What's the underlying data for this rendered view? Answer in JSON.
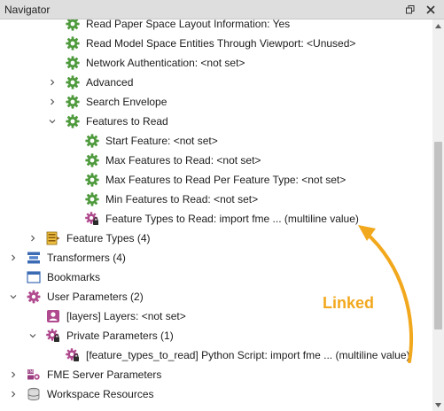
{
  "panel": {
    "title": "Navigator"
  },
  "annotation": {
    "text": "Linked",
    "color": "#f2a81d"
  },
  "tree": [
    {
      "id": "read-paper-space",
      "label": "Read Paper Space Layout Information: Yes",
      "icon": "gear-icon",
      "expander": "none"
    },
    {
      "id": "read-model-space",
      "label": "Read Model Space Entities Through Viewport: <Unused>",
      "icon": "gear-icon",
      "expander": "none"
    },
    {
      "id": "network-authentication",
      "label": "Network Authentication: <not set>",
      "icon": "gear-icon",
      "expander": "none"
    },
    {
      "id": "advanced",
      "label": "Advanced",
      "icon": "gear-icon",
      "expander": "collapsed"
    },
    {
      "id": "search-envelope",
      "label": "Search Envelope",
      "icon": "gear-icon",
      "expander": "collapsed"
    },
    {
      "id": "features-to-read",
      "label": "Features to Read",
      "icon": "gear-icon",
      "expander": "expanded"
    },
    {
      "id": "start-feature",
      "label": "Start Feature: <not set>",
      "icon": "gear-icon",
      "expander": "none"
    },
    {
      "id": "max-features",
      "label": "Max Features to Read: <not set>",
      "icon": "gear-icon",
      "expander": "none"
    },
    {
      "id": "max-features-per-type",
      "label": "Max Features to Read Per Feature Type: <not set>",
      "icon": "gear-icon",
      "expander": "none"
    },
    {
      "id": "min-features",
      "label": "Min Features to Read: <not set>",
      "icon": "gear-icon",
      "expander": "none"
    },
    {
      "id": "feature-types-to-read",
      "label": "Feature Types to Read: import fme ... (multiline value)",
      "icon": "linked-gear-icon",
      "expander": "none"
    },
    {
      "id": "feature-types",
      "label": "Feature Types (4)",
      "icon": "feature-types-icon",
      "expander": "collapsed"
    },
    {
      "id": "transformers",
      "label": "Transformers (4)",
      "icon": "transformers-icon",
      "expander": "collapsed"
    },
    {
      "id": "bookmarks",
      "label": "Bookmarks",
      "icon": "bookmark-icon",
      "expander": "none"
    },
    {
      "id": "user-parameters",
      "label": "User Parameters (2)",
      "icon": "user-parameters-icon",
      "expander": "expanded"
    },
    {
      "id": "layers",
      "label": "[layers] Layers: <not set>",
      "icon": "user-parameter-icon",
      "expander": "none"
    },
    {
      "id": "private-parameters",
      "label": "Private Parameters (1)",
      "icon": "private-parameters-icon",
      "expander": "expanded"
    },
    {
      "id": "feature-types-to-read-param",
      "label": "[feature_types_to_read] Python Script: import fme ... (multiline value)",
      "icon": "private-parameter-icon",
      "expander": "none"
    },
    {
      "id": "fme-server-parameters",
      "label": "FME Server Parameters",
      "icon": "server-parameters-icon",
      "expander": "collapsed"
    },
    {
      "id": "workspace-resources",
      "label": "Workspace Resources",
      "icon": "database-icon",
      "expander": "collapsed"
    }
  ]
}
